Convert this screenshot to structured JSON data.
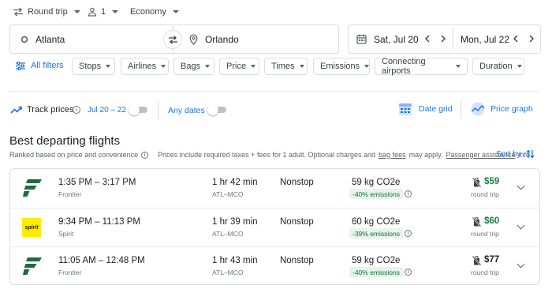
{
  "trip": {
    "trip_type": "Round trip",
    "passengers": "1",
    "cabin": "Economy"
  },
  "search": {
    "origin": "Atlanta",
    "destination": "Orlando",
    "depart_date": "Sat, Jul 20",
    "return_date": "Mon, Jul 22"
  },
  "filters": {
    "all_filters": "All filters",
    "chips": [
      "Stops",
      "Airlines",
      "Bags",
      "Price",
      "Times",
      "Emissions",
      "Connecting airports",
      "Duration"
    ]
  },
  "tracking": {
    "track_prices": "Track prices",
    "date_range": "Jul 20 – 22",
    "any_dates": "Any dates",
    "date_grid": "Date grid",
    "price_graph": "Price graph"
  },
  "section": {
    "title": "Best departing flights",
    "ranked_note": "Ranked based on price and convenience",
    "prices_note": "Prices include required taxes + fees for 1 adult. Optional charges and",
    "bag_fees": "bag fees",
    "may_apply": "may apply.",
    "passenger_assistance": "Passenger assistance",
    "info_suffix": "info.",
    "sort_by": "Sort by:"
  },
  "flights": [
    {
      "times": "1:35 PM – 3:17 PM",
      "airline": "Frontier",
      "duration": "1 hr 42 min",
      "route": "ATL–MCO",
      "stops": "Nonstop",
      "co2": "59 kg CO2e",
      "emissions_badge": "-40% emissions",
      "price": "$59",
      "price_color": "#188038",
      "price_note": "round trip"
    },
    {
      "times": "9:34 PM – 11:13 PM",
      "airline": "Spirit",
      "duration": "1 hr 39 min",
      "route": "ATL–MCO",
      "stops": "Nonstop",
      "co2": "60 kg CO2e",
      "emissions_badge": "-39% emissions",
      "price": "$60",
      "price_color": "#188038",
      "price_note": "round trip"
    },
    {
      "times": "11:05 AM – 12:48 PM",
      "airline": "Frontier",
      "duration": "1 hr 43 min",
      "route": "ATL–MCO",
      "stops": "Nonstop",
      "co2": "59 kg CO2e",
      "emissions_badge": "-40% emissions",
      "price": "$77",
      "price_color": "#202124",
      "price_note": "round trip"
    }
  ],
  "logos": {
    "spirit_text": "spirit"
  },
  "colors": {
    "accent": "#1a73e8",
    "frontier_green": "#1e6b3c",
    "spirit_yellow": "#ffec00",
    "emissions_bg": "#e6f4ea",
    "emissions_text": "#137333"
  }
}
